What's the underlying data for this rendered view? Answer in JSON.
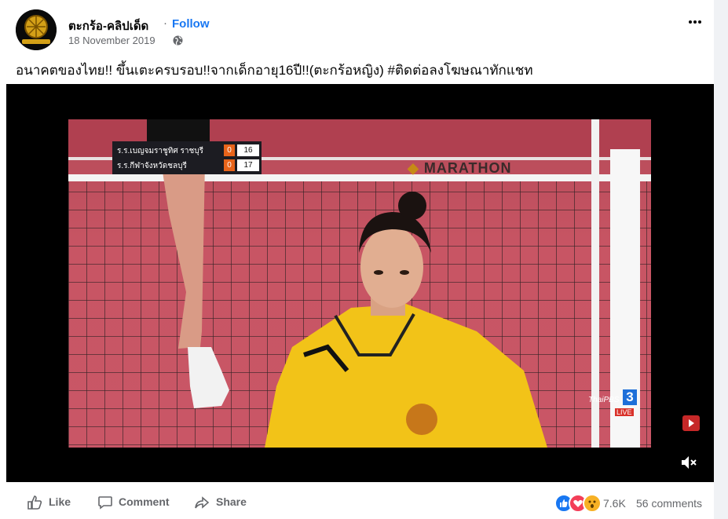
{
  "post": {
    "page_name": "ตะกร้อ-คลิปเด็ด",
    "separator": "·",
    "follow_label": "Follow",
    "date": "18 November 2019",
    "caption": "อนาคตของไทย!! ขึ้นเตะครบรอบ!!จากเด็กอายุ16ปี!!(ตะกร้อหญิง) #ติดต่อลงโฆษณาทักแชท"
  },
  "video": {
    "scoreboard": [
      {
        "team": "ร.ร.เบญจมราชูทิศ ราชบุรี",
        "sets": "0",
        "points": "16"
      },
      {
        "team": "ร.ร.กีฬาจังหวัดชลบุรี",
        "sets": "0",
        "points": "17"
      }
    ],
    "sponsor": "MARATHON",
    "channel": "ThaiPBS",
    "channel_number": "3",
    "live_label": "LIVE"
  },
  "actions": {
    "like_label": "Like",
    "comment_label": "Comment",
    "share_label": "Share",
    "reactions_count": "7.6K",
    "comments_label": "56 comments"
  },
  "colors": {
    "accent": "#1877f2",
    "court": "#c95666",
    "jersey": "#f2c318"
  },
  "icons": [
    "globe-icon",
    "more-icon",
    "mute-icon",
    "like-icon",
    "comment-icon",
    "share-icon",
    "youtube-icon"
  ]
}
